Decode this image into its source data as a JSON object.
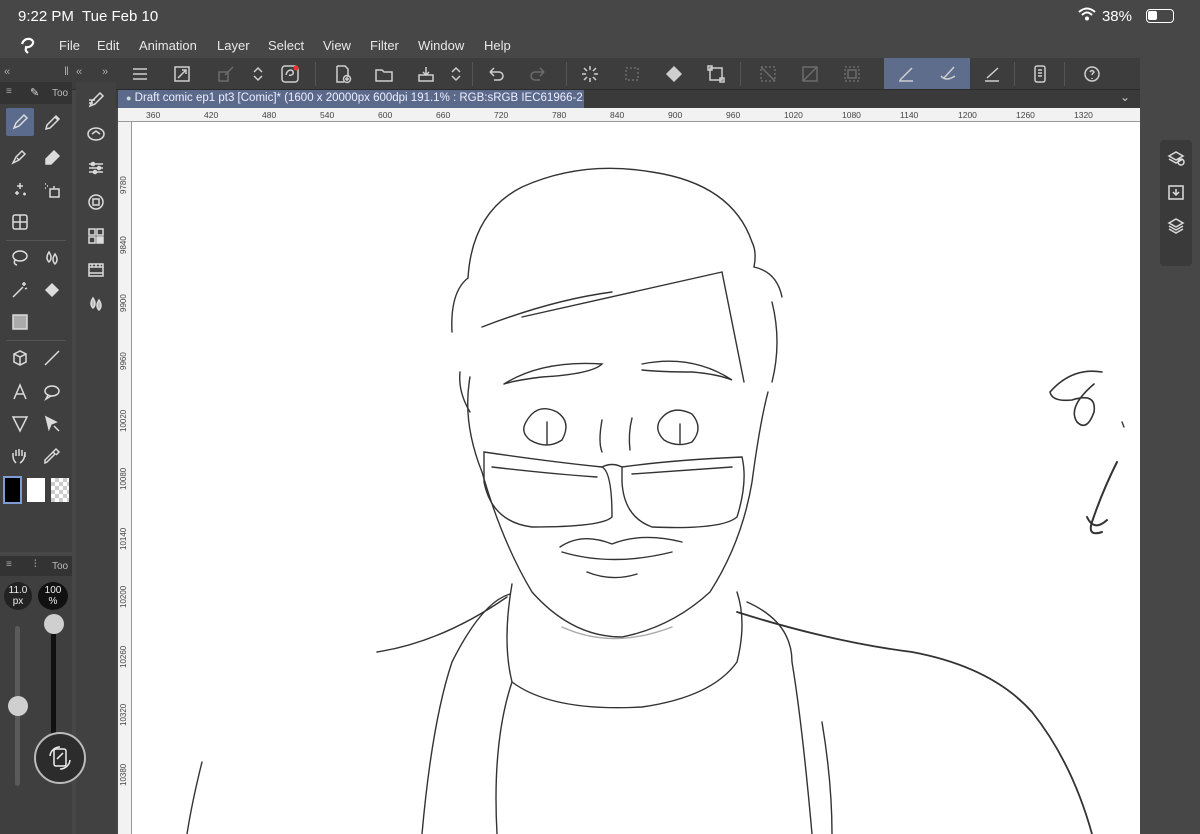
{
  "status": {
    "time": "9:22 PM",
    "date": "Tue Feb 10",
    "battery": "38%"
  },
  "menu": [
    "File",
    "Edit",
    "Animation",
    "Layer",
    "Select",
    "View",
    "Filter",
    "Window",
    "Help"
  ],
  "document": {
    "tab_title": "Draft comic ep1 pt3 [Comic]* (1600 x 20000px 600dpi 191.1% : RGB:sRGB IEC61966-2.1)"
  },
  "ruler_top": [
    "360",
    "420",
    "480",
    "540",
    "600",
    "660",
    "720",
    "780",
    "840",
    "900",
    "960",
    "1020",
    "1080",
    "1140",
    "1200",
    "1260",
    "1320"
  ],
  "ruler_left": [
    "9780",
    "9840",
    "9900",
    "9960",
    "10020",
    "10080",
    "10140",
    "10200",
    "10260",
    "10320",
    "10380"
  ],
  "tool_panel": {
    "tab_label": "Too",
    "sub_tab_label": "Too"
  },
  "brush": {
    "size": "11.0",
    "size_unit": "px",
    "opacity": "100",
    "opacity_unit": "%"
  }
}
